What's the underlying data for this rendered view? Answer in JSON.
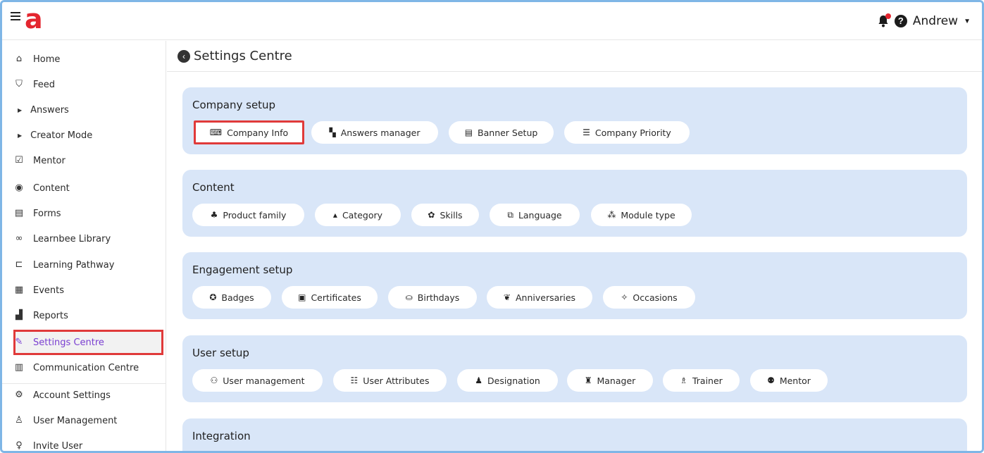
{
  "header": {
    "logo_text": "a",
    "user_name": "Andrew",
    "brand_color": "#e4262f"
  },
  "sidebar": {
    "items": [
      {
        "label": "Home",
        "icon": "home-icon"
      },
      {
        "label": "Feed",
        "icon": "feed-icon"
      },
      {
        "label": "Answers",
        "icon": "expand-triangle-icon"
      },
      {
        "label": "Creator Mode",
        "icon": "expand-triangle-icon"
      },
      {
        "label": "Mentor",
        "icon": "checkbox-icon"
      },
      {
        "label": "Content",
        "icon": "content-icon"
      },
      {
        "label": "Forms",
        "icon": "forms-icon"
      },
      {
        "label": "Learnbee Library",
        "icon": "library-icon"
      },
      {
        "label": "Learning Pathway",
        "icon": "pathway-icon"
      },
      {
        "label": "Events",
        "icon": "calendar-icon"
      },
      {
        "label": "Reports",
        "icon": "reports-icon"
      },
      {
        "label": "Settings Centre",
        "icon": "settings-wand-icon",
        "active": true
      },
      {
        "label": "Communication Centre",
        "icon": "communication-icon"
      },
      {
        "label": "Account Settings",
        "icon": "account-settings-icon"
      },
      {
        "label": "User Management",
        "icon": "user-management-icon"
      },
      {
        "label": "Invite User",
        "icon": "invite-user-icon"
      }
    ],
    "active_color": "#7a3fd1"
  },
  "main": {
    "title": "Settings Centre",
    "sections": [
      {
        "title": "Company setup",
        "buttons": [
          {
            "label": "Company Info",
            "icon": "company-info-icon",
            "highlighted": true
          },
          {
            "label": "Answers manager",
            "icon": "answers-manager-icon"
          },
          {
            "label": "Banner Setup",
            "icon": "banner-icon"
          },
          {
            "label": "Company Priority",
            "icon": "priority-icon"
          }
        ]
      },
      {
        "title": "Content",
        "buttons": [
          {
            "label": "Product family",
            "icon": "product-family-icon"
          },
          {
            "label": "Category",
            "icon": "category-icon"
          },
          {
            "label": "Skills",
            "icon": "skills-icon"
          },
          {
            "label": "Language",
            "icon": "language-icon"
          },
          {
            "label": "Module type",
            "icon": "module-type-icon"
          }
        ]
      },
      {
        "title": "Engagement setup",
        "buttons": [
          {
            "label": "Badges",
            "icon": "badge-icon"
          },
          {
            "label": "Certificates",
            "icon": "certificate-icon"
          },
          {
            "label": "Birthdays",
            "icon": "birthday-cake-icon"
          },
          {
            "label": "Anniversaries",
            "icon": "anniversary-icon"
          },
          {
            "label": "Occasions",
            "icon": "party-popper-icon"
          }
        ]
      },
      {
        "title": "User setup",
        "buttons": [
          {
            "label": "User management",
            "icon": "users-icon"
          },
          {
            "label": "User Attributes",
            "icon": "attributes-icon"
          },
          {
            "label": "Designation",
            "icon": "designation-icon"
          },
          {
            "label": "Manager",
            "icon": "manager-icon"
          },
          {
            "label": "Trainer",
            "icon": "trainer-icon"
          },
          {
            "label": "Mentor",
            "icon": "mentor-icon"
          }
        ]
      },
      {
        "title": "Integration",
        "buttons": []
      }
    ]
  }
}
